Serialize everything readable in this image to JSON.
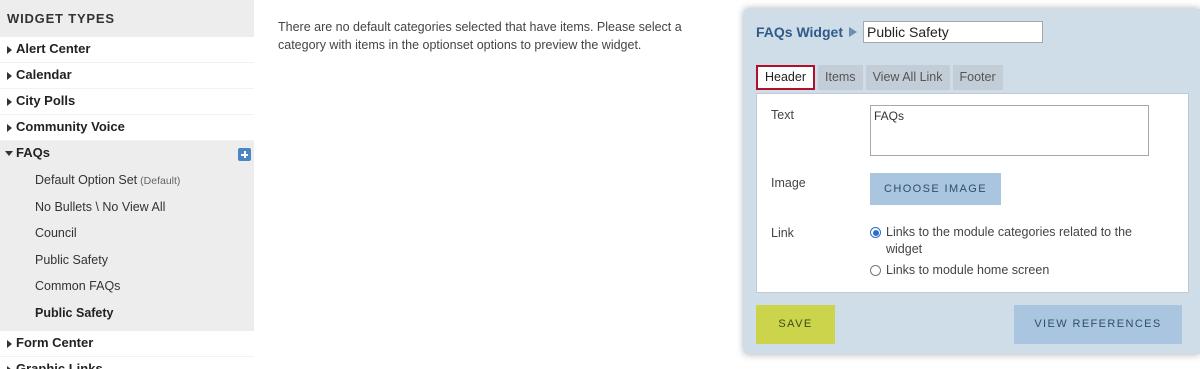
{
  "sidebar": {
    "title": "WIDGET TYPES",
    "items_before": [
      {
        "label": "Alert Center"
      },
      {
        "label": "Calendar"
      },
      {
        "label": "City Polls"
      },
      {
        "label": "Community Voice"
      }
    ],
    "open_item": {
      "label": "FAQs",
      "add_icon": "plus-icon"
    },
    "subitems": [
      {
        "label": "Default Option Set",
        "tag": "(Default)"
      },
      {
        "label": "No Bullets \\ No View All"
      },
      {
        "label": "Council"
      },
      {
        "label": "Public Safety"
      },
      {
        "label": "Common FAQs"
      },
      {
        "label": "Public Safety"
      }
    ],
    "items_after": [
      {
        "label": "Form Center"
      },
      {
        "label": "Graphic Links"
      }
    ]
  },
  "message": "There are no default categories selected that have items. Please select a category with items in the optionset options to preview the widget.",
  "panel": {
    "title": "FAQs Widget",
    "name_value": "Public Safety",
    "tabs": [
      {
        "label": "Header"
      },
      {
        "label": "Items"
      },
      {
        "label": "View All Link"
      },
      {
        "label": "Footer"
      }
    ],
    "header": {
      "text_label": "Text",
      "text_value": "FAQs",
      "image_label": "Image",
      "choose_image_label": "CHOOSE IMAGE",
      "link_label": "Link",
      "link_options": [
        {
          "label": "Links to the module categories related to the widget",
          "selected": true
        },
        {
          "label": "Links to module home screen",
          "selected": false
        }
      ]
    },
    "save_label": "SAVE",
    "view_references_label": "VIEW REFERENCES"
  },
  "colors": {
    "accent": "#2f5b8a",
    "active_tab_border": "#b0102a",
    "save_button": "#cbd44a",
    "secondary_button": "#a9c5df",
    "panel_bg": "#cfdde9"
  }
}
